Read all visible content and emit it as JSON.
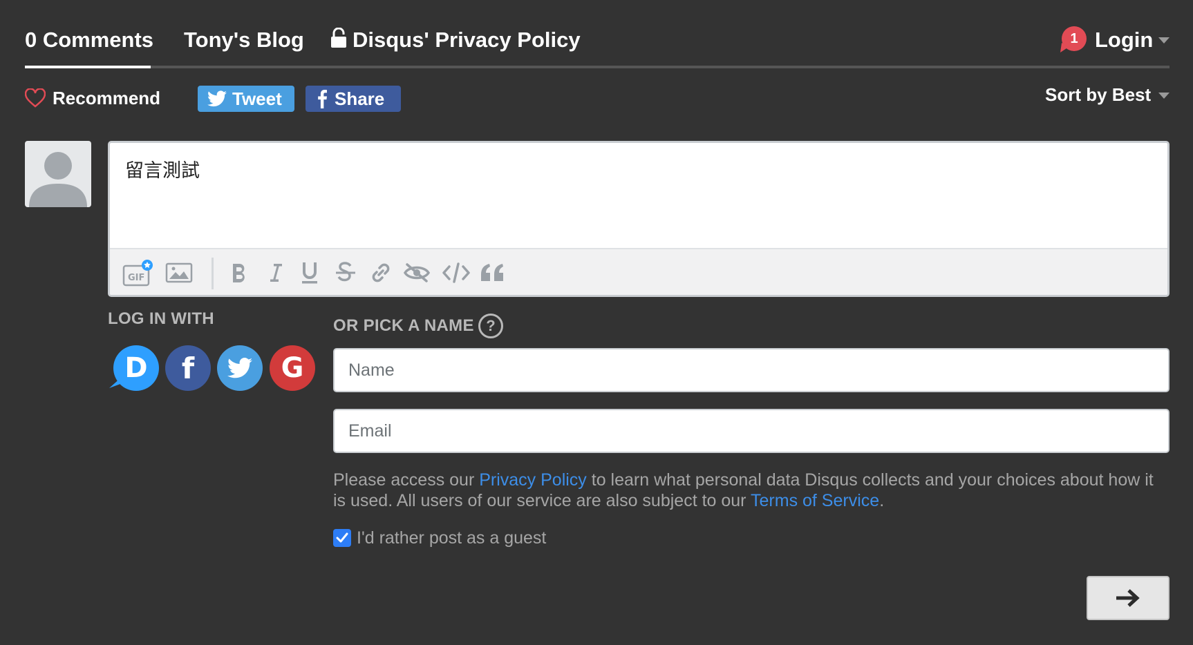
{
  "nav": {
    "comments_tab": "0 Comments",
    "blog_tab": "Tony's Blog",
    "privacy_tab": "Disqus' Privacy Policy",
    "notification_count": "1",
    "login_label": "Login"
  },
  "actions": {
    "recommend_label": "Recommend",
    "tweet_label": "Tweet",
    "share_label": "Share",
    "sort_label": "Sort by Best"
  },
  "editor": {
    "text": "留言測試",
    "toolbar_icons": [
      "gif-icon",
      "image-icon",
      "bold-icon",
      "italic-icon",
      "underline-icon",
      "strikethrough-icon",
      "link-icon",
      "spoiler-icon",
      "code-icon",
      "quote-icon"
    ]
  },
  "login": {
    "log_in_with_label": "LOG IN WITH",
    "providers": [
      "disqus",
      "facebook",
      "twitter",
      "google"
    ],
    "provider_letters": {
      "disqus": "D",
      "facebook": "f",
      "google": "G"
    },
    "pick_name_label": "OR PICK A NAME",
    "help_symbol": "?",
    "name_placeholder": "Name",
    "email_placeholder": "Email",
    "privacy_prefix": "Please access our ",
    "privacy_link": "Privacy Policy",
    "privacy_middle": " to learn what personal data Disqus collects and your choices about how it is used. All users of our service are also subject to our ",
    "terms_link": "Terms of Service",
    "privacy_suffix": ".",
    "guest_label": "I'd rather post as a guest",
    "guest_checked": true
  },
  "colors": {
    "background": "#333333",
    "badge": "#e24b55",
    "tweet": "#4a9fe0",
    "facebook": "#3e5b9d",
    "disqus": "#2e9fff",
    "google": "#d23b3b",
    "link": "#3d8ee8"
  }
}
